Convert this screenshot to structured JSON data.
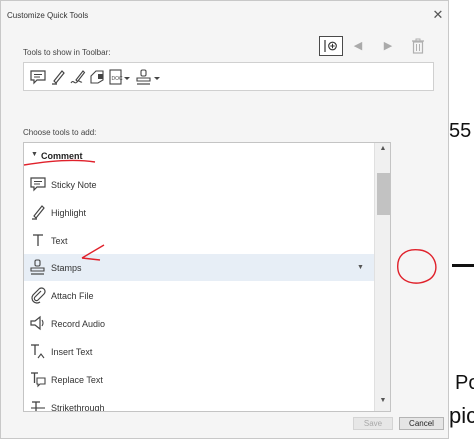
{
  "background": {
    "fragment_top": "55",
    "fragment_mid": "Po",
    "fragment_bottom": "pic"
  },
  "dialog": {
    "title": "Customize Quick Tools",
    "close_icon": "close-icon",
    "toolbar_section_label": "Tools to show in Toolbar:",
    "toolbar_actions": [
      "insert-separator-icon",
      "move-left-icon",
      "move-right-icon",
      "trash-icon"
    ],
    "toolbar_icons": [
      "sticky-note-icon",
      "highlight-icon",
      "draw-free-form-icon",
      "stamp-icon",
      "attach-file-icon",
      "stamps-dropdown-icon"
    ],
    "choose_section_label": "Choose tools to add:",
    "category": "Comment",
    "tools": [
      {
        "label": "Sticky Note",
        "icon": "sticky-note-icon"
      },
      {
        "label": "Highlight",
        "icon": "highlight-icon"
      },
      {
        "label": "Text",
        "icon": "text-icon"
      },
      {
        "label": "Stamps",
        "icon": "stamp-icon",
        "selected": true
      },
      {
        "label": "Attach File",
        "icon": "paperclip-icon"
      },
      {
        "label": "Record Audio",
        "icon": "speaker-icon"
      },
      {
        "label": "Insert Text",
        "icon": "insert-text-icon"
      },
      {
        "label": "Replace Text",
        "icon": "replace-text-icon"
      },
      {
        "label": "Strikethrough",
        "icon": "strikethrough-icon"
      }
    ],
    "save_label": "Save",
    "cancel_label": "Cancel"
  },
  "colors": {
    "annotation": "#e0212b",
    "selected_row": "#e7eef6",
    "dialog_bg": "#f5f5f5"
  }
}
